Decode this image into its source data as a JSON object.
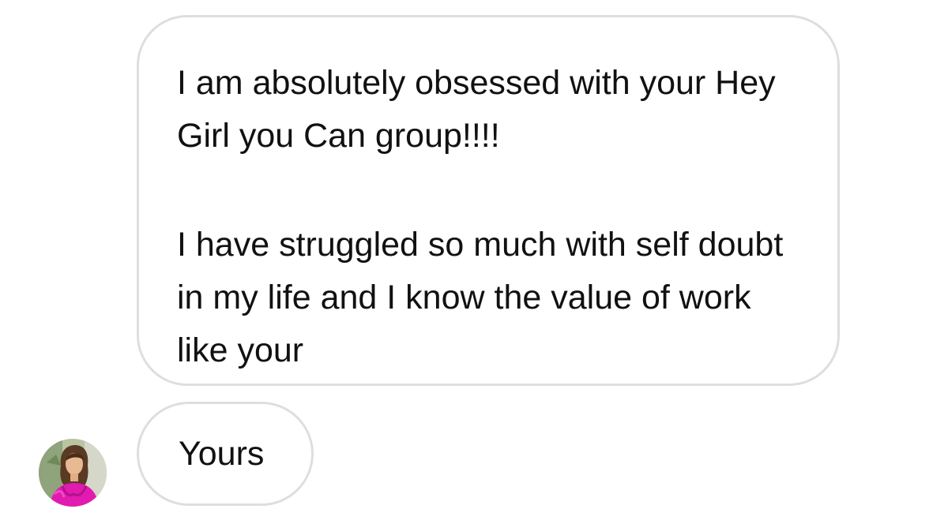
{
  "conversation": {
    "messages": [
      {
        "paragraphs": [
          "I am absolutely obsessed with your Hey Girl you Can group!!!!",
          "I have struggled so much with self doubt in my life and I know the value of work like your"
        ]
      },
      {
        "text": "Yours"
      }
    ],
    "sender": {
      "avatar": "profile-photo"
    }
  },
  "colors": {
    "bubble_border": "#dedede",
    "text": "#111111",
    "background": "#ffffff",
    "avatar_top": "#e21ab0"
  }
}
